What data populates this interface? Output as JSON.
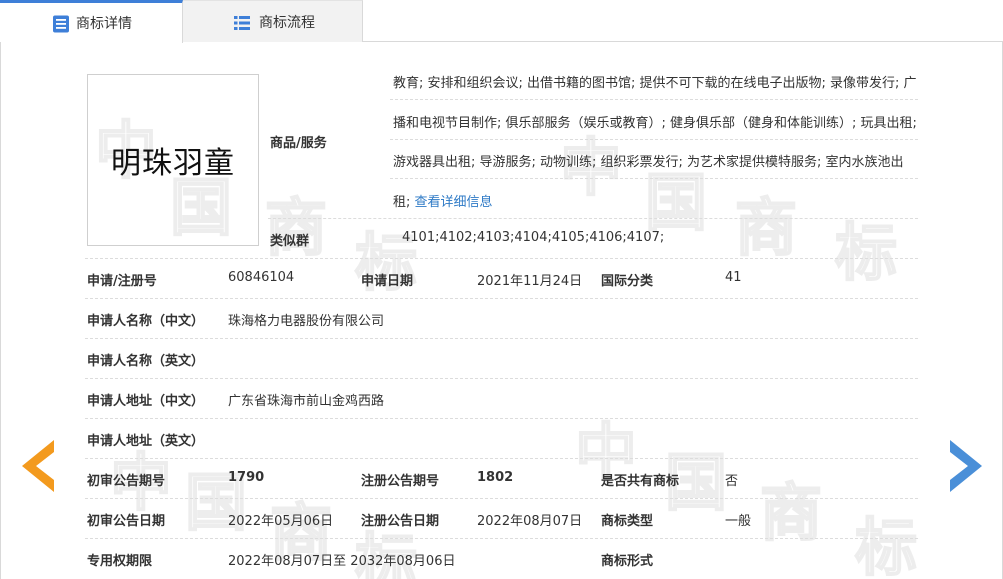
{
  "tabs": [
    {
      "label": "商标详情",
      "icon": "document-list-icon",
      "active": true
    },
    {
      "label": "商标流程",
      "icon": "list-icon",
      "active": false
    }
  ],
  "logo_text": "明珠羽童",
  "goods": {
    "label": "商品/服务",
    "text": "教育; 安排和组织会议; 出借书籍的图书馆; 提供不可下载的在线电子出版物; 录像带发行; 广播和电视节目制作; 俱乐部服务（娱乐或教育）; 健身俱乐部（健身和体能训练）; 玩具出租; 游戏器具出租; 导游服务; 动物训练; 组织彩票发行; 为艺术家提供模特服务; 室内水族池出租; ",
    "link": "查看详细信息"
  },
  "similar_group": {
    "label": "类似群",
    "value": "4101;4102;4103;4104;4105;4106;4107;"
  },
  "fields": {
    "reg_no_label": "申请/注册号",
    "reg_no": "60846104",
    "apply_date_label": "申请日期",
    "apply_date": "2021年11月24日",
    "intl_class_label": "国际分类",
    "intl_class": "41",
    "applicant_cn_label": "申请人名称（中文）",
    "applicant_cn": "珠海格力电器股份有限公司",
    "applicant_en_label": "申请人名称（英文）",
    "applicant_en": "",
    "address_cn_label": "申请人地址（中文）",
    "address_cn": "广东省珠海市前山金鸡西路",
    "address_en_label": "申请人地址（英文）",
    "address_en": "",
    "prelim_no_label": "初审公告期号",
    "prelim_no": "1790",
    "reg_pub_no_label": "注册公告期号",
    "reg_pub_no": "1802",
    "shared_label": "是否共有商标",
    "shared": "否",
    "prelim_date_label": "初审公告日期",
    "prelim_date": "2022年05月06日",
    "reg_pub_date_label": "注册公告日期",
    "reg_pub_date": "2022年08月07日",
    "type_label": "商标类型",
    "type": "一般",
    "term_label": "专用权期限",
    "term": "2022年08月07日至 2032年08月06日",
    "form_label": "商标形式",
    "form": ""
  },
  "watermark": [
    "中",
    "国",
    "商",
    "标",
    "中",
    "国",
    "商",
    "标",
    "中",
    "国",
    "商",
    "标",
    "中",
    "国",
    "商",
    "标"
  ],
  "colors": {
    "accent": "#3e7fd8",
    "link": "#2e7ac6",
    "arrow_left": "#f39a1e",
    "arrow_right": "#4a8fd8"
  }
}
